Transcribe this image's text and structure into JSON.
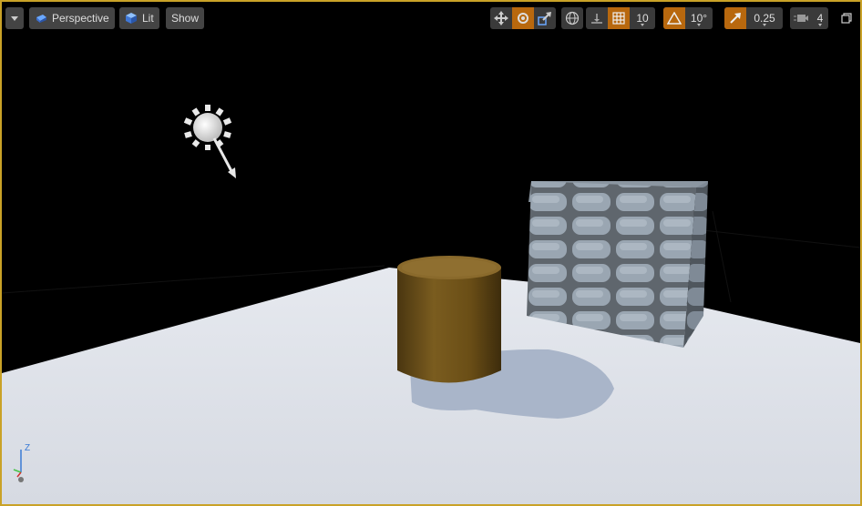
{
  "toolbar": {
    "view_mode": "Perspective",
    "lighting_mode": "Lit",
    "show_label": "Show",
    "grid_snap_value": "10",
    "rotation_snap_value": "10°",
    "scale_snap_value": "0.25",
    "camera_speed_value": "4"
  },
  "axis_gizmo": {
    "z_label": "Z"
  },
  "colors": {
    "viewport_border": "#c9a227",
    "active_toggle": "#b8680e",
    "toolbar_button": "#444444",
    "floor": "#dfe3ea",
    "cylinder_wood": "#6b5018",
    "stone_block": "#8e9aa6"
  },
  "icons": [
    "dropdown-arrow-icon",
    "perspective-cube-icon",
    "lit-cube-icon",
    "translate-icon",
    "rotate-icon",
    "scale-icon",
    "world-local-icon",
    "surface-snap-icon",
    "grid-icon",
    "angle-icon",
    "scale-arrow-icon",
    "camera-speed-icon",
    "maximize-icon",
    "light-bulb-icon"
  ]
}
